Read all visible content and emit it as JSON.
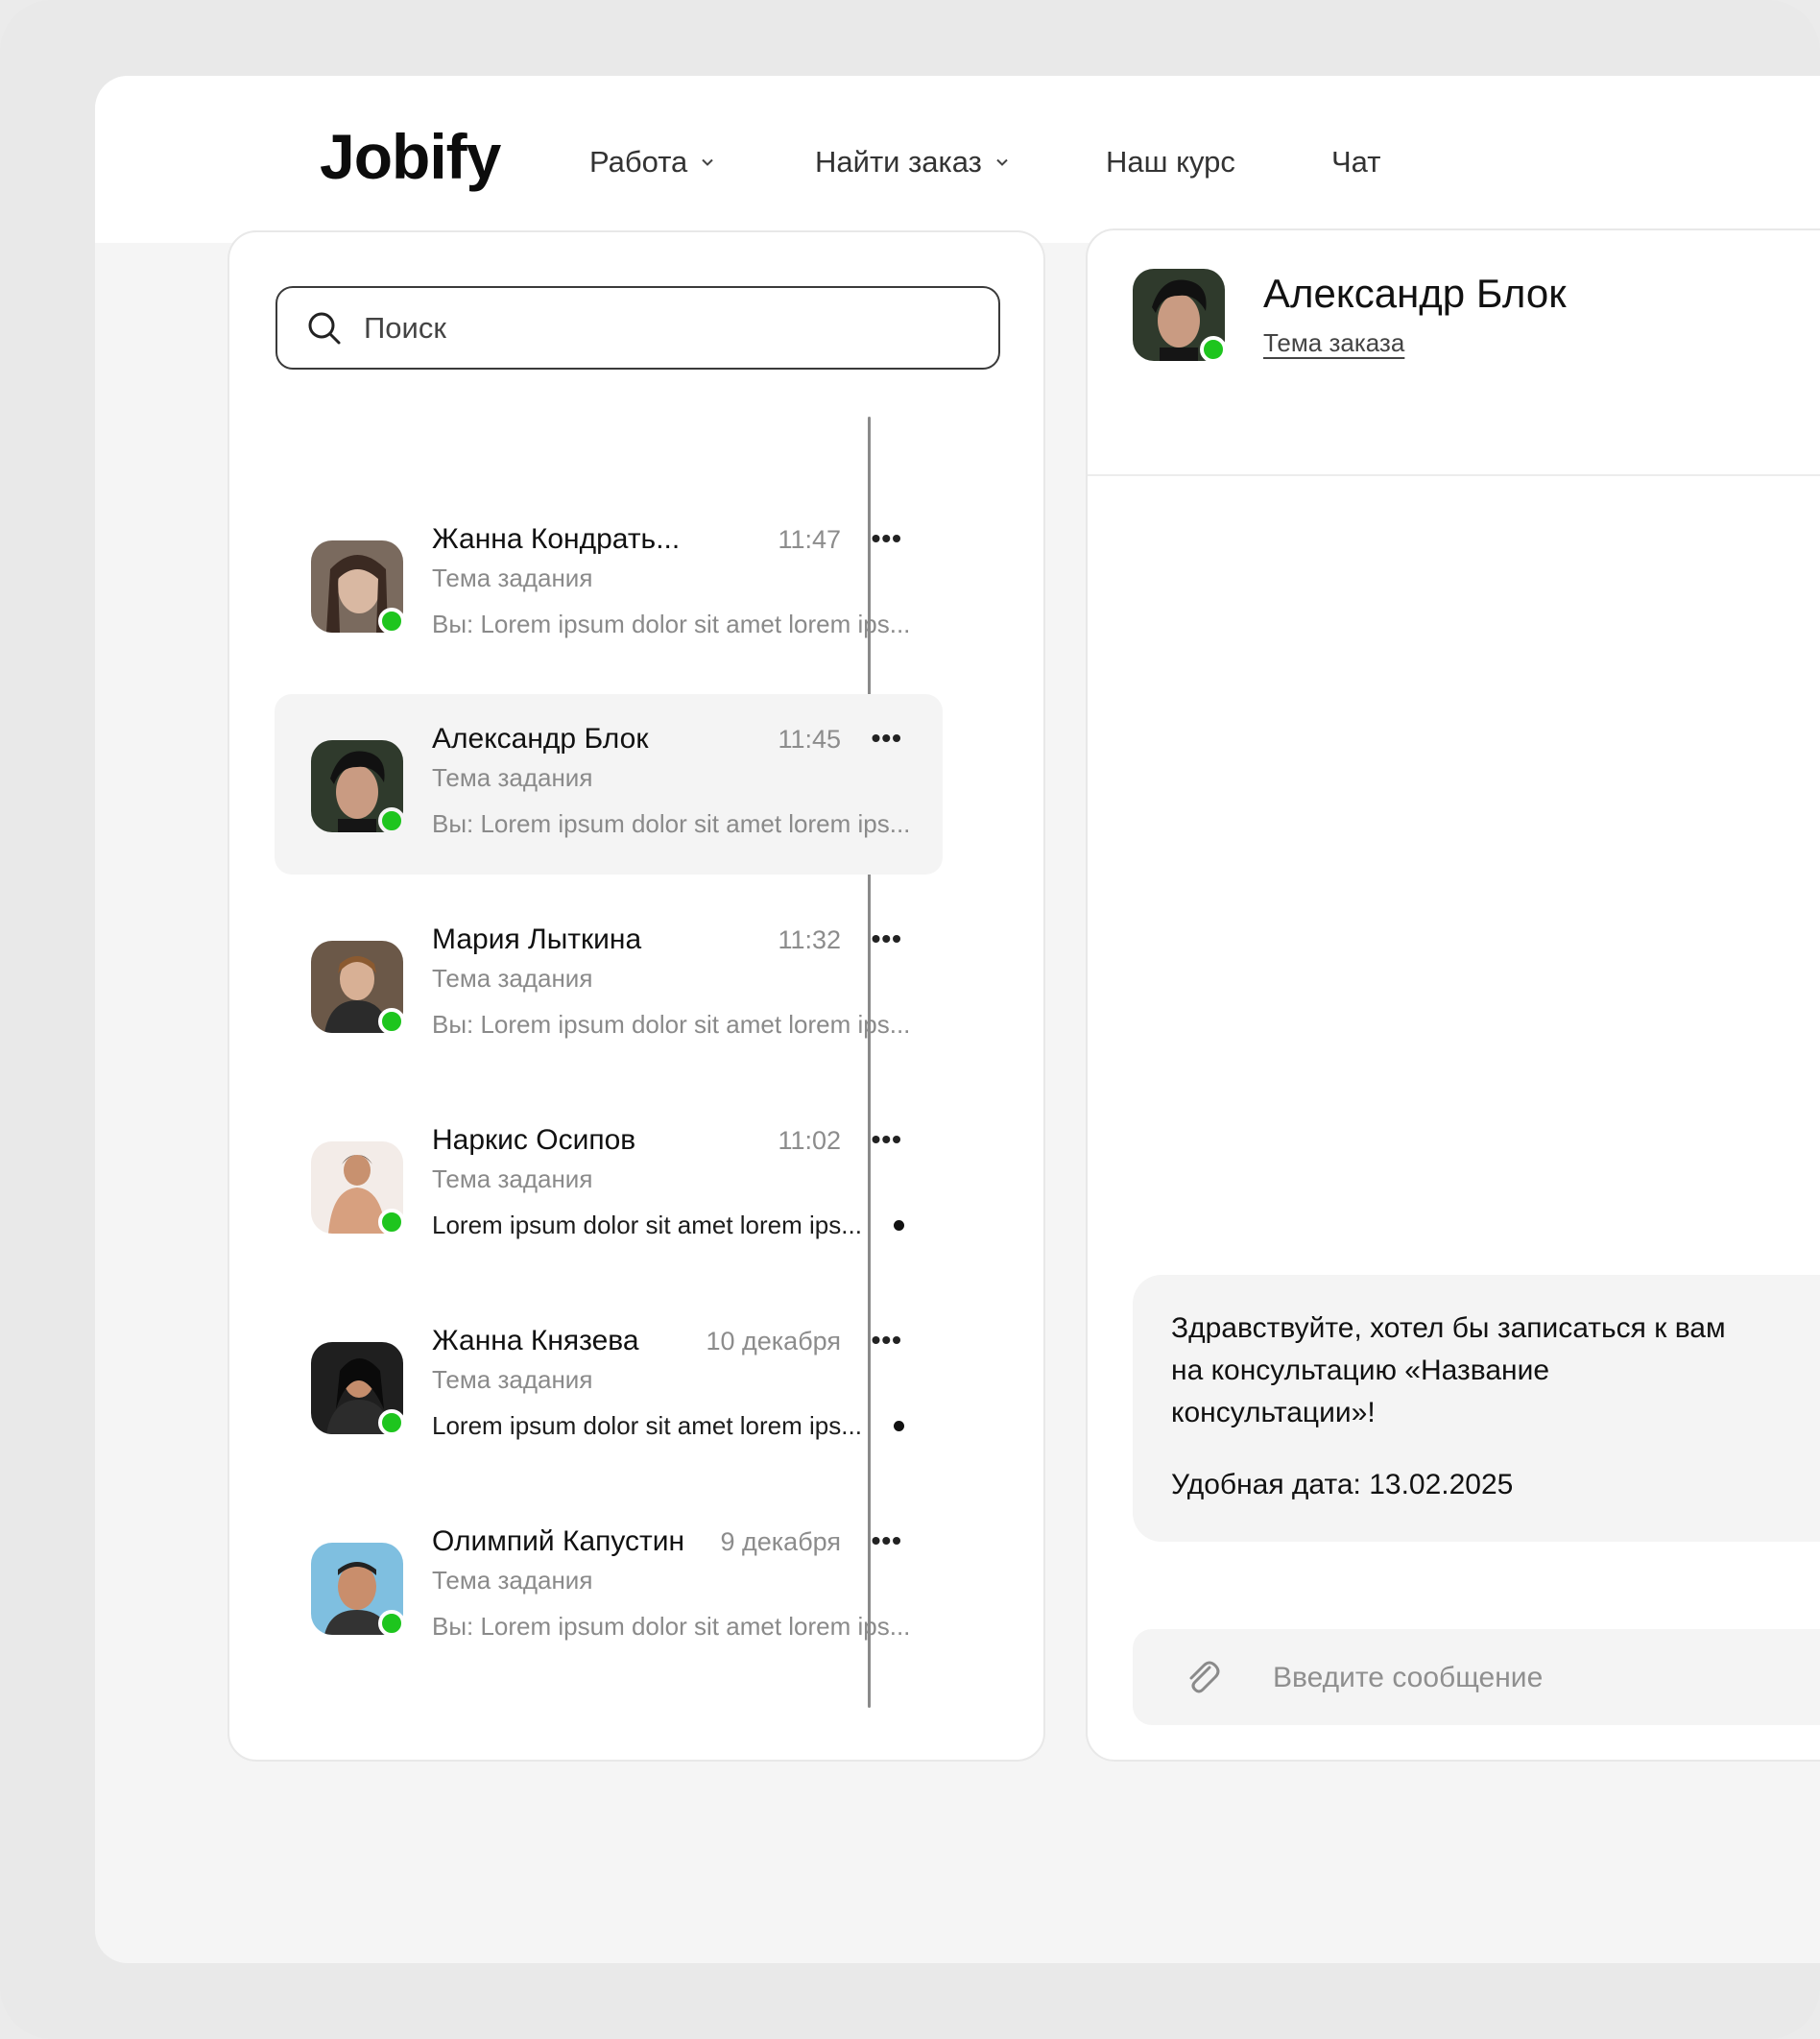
{
  "header": {
    "logo": "Jobify",
    "nav": [
      {
        "label": "Работа",
        "has_dropdown": true
      },
      {
        "label": "Найти заказ",
        "has_dropdown": true
      },
      {
        "label": "Наш курс",
        "has_dropdown": false
      },
      {
        "label": "Чат",
        "has_dropdown": false
      }
    ]
  },
  "search": {
    "placeholder": "Поиск"
  },
  "chats": [
    {
      "name": "Жанна Кондрать...",
      "time": "11:47",
      "topic": "Тема задания",
      "preview": "Вы: Lorem ipsum dolor sit amet lorem ips...",
      "unread": false,
      "active": false,
      "online": true
    },
    {
      "name": "Александр Блок",
      "time": "11:45",
      "topic": "Тема задания",
      "preview": "Вы: Lorem ipsum dolor sit amet lorem ips...",
      "unread": false,
      "active": true,
      "online": true
    },
    {
      "name": "Мария Лыткина",
      "time": "11:32",
      "topic": "Тема задания",
      "preview": "Вы: Lorem ipsum dolor sit amet lorem ips...",
      "unread": false,
      "active": false,
      "online": true
    },
    {
      "name": "Наркис Осипов",
      "time": "11:02",
      "topic": "Тема задания",
      "preview": "Lorem ipsum dolor sit amet lorem ips...",
      "unread": true,
      "active": false,
      "online": true
    },
    {
      "name": "Жанна Князева",
      "time": "10 декабря",
      "topic": "Тема задания",
      "preview": "Lorem ipsum dolor sit amet lorem ips...",
      "unread": true,
      "active": false,
      "online": true
    },
    {
      "name": "Олимпий Капустин",
      "time": "9 декабря",
      "topic": "Тема задания",
      "preview": "Вы: Lorem ipsum dolor sit amet lorem ips...",
      "unread": false,
      "active": false,
      "online": true
    }
  ],
  "conversation": {
    "contact_name": "Александр Блок",
    "contact_topic": "Тема заказа",
    "message_text": "Здравствуйте, хотел бы записаться к вам\nна консультацию «Название\nконсультации»!",
    "message_date": "Удобная дата: 13.02.2025",
    "composer_placeholder": "Введите сообщение"
  },
  "icons": {
    "search": "search-icon",
    "more": "more-icon",
    "attach": "paperclip-icon",
    "chevron": "chevron-down-icon"
  },
  "colors": {
    "online": "#1ec51e",
    "background": "#f5f5f5",
    "active_row": "#f4f4f4"
  }
}
